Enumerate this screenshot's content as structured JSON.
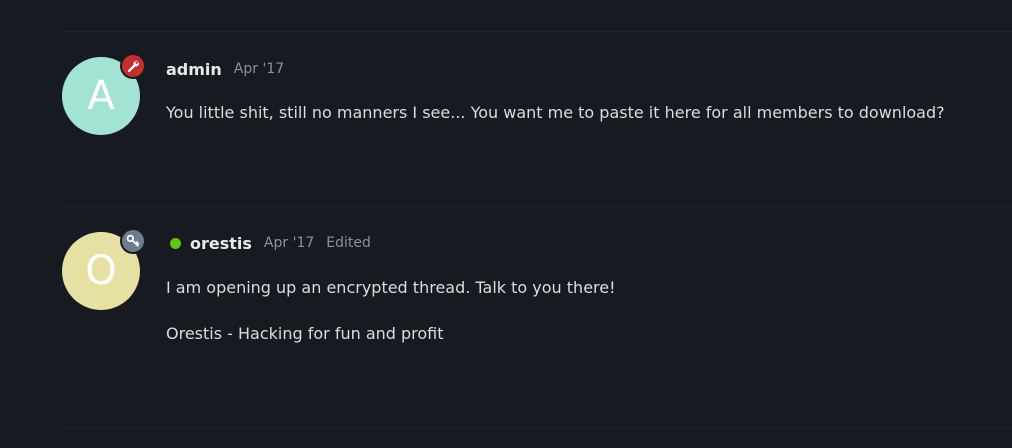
{
  "colors": {
    "background": "#171a21",
    "divider": "#20242c",
    "admin_avatar": "#a3e3d4",
    "orestis_avatar": "#e6e0a3",
    "admin_badge": "#c62e2e",
    "orestis_badge": "#6f7c8c",
    "online": "#5fc417"
  },
  "posts": [
    {
      "avatar_letter": "A",
      "badge_icon": "wrench-icon",
      "username": "admin",
      "date": "Apr '17",
      "edited": "",
      "online": false,
      "paragraphs": [
        "You little shit, still no manners I see... You want me to paste it here for all members to download?"
      ]
    },
    {
      "avatar_letter": "O",
      "badge_icon": "key-icon",
      "username": "orestis",
      "date": "Apr '17",
      "edited": "Edited",
      "online": true,
      "paragraphs": [
        "I am opening up an encrypted thread. Talk to you there!",
        "Orestis - Hacking for fun and profit"
      ]
    }
  ]
}
